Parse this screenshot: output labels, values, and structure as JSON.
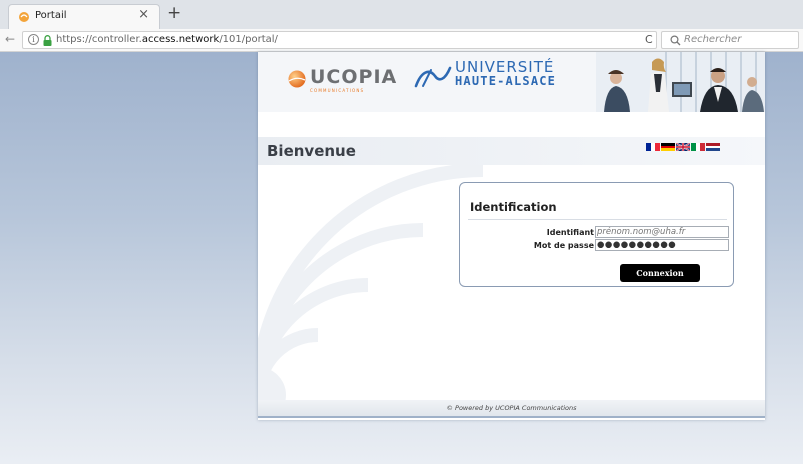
{
  "browser": {
    "tab_title": "Portail",
    "tab_close": "×",
    "new_tab": "+",
    "back": "←",
    "info": "i",
    "url_prefix": "https://controller.",
    "url_domain": "access.network",
    "url_suffix": "/101/portal/",
    "reload": "C",
    "search_placeholder": "Rechercher"
  },
  "portal": {
    "ucopia_name": "UCOPIA",
    "ucopia_sub": "COMMUNICATIONS",
    "uha_line1": "UNIVERSITÉ",
    "uha_line2": "HAUTE-ALSACE",
    "welcome": "Bienvenue",
    "languages": [
      "fr",
      "de",
      "en",
      "it",
      "nl"
    ],
    "login": {
      "title": "Identification",
      "user_label": "Identifiant",
      "user_placeholder": "prénom.nom@uha.fr",
      "pass_label": "Mot de passe",
      "pass_value": "●●●●●●●●●●",
      "submit": "Connexion"
    },
    "footer": "© Powered by UCOPIA Communications"
  },
  "colors": {
    "accent_blue": "#2d69b3",
    "ucopia_orange": "#e87722",
    "button_black": "#000000"
  }
}
